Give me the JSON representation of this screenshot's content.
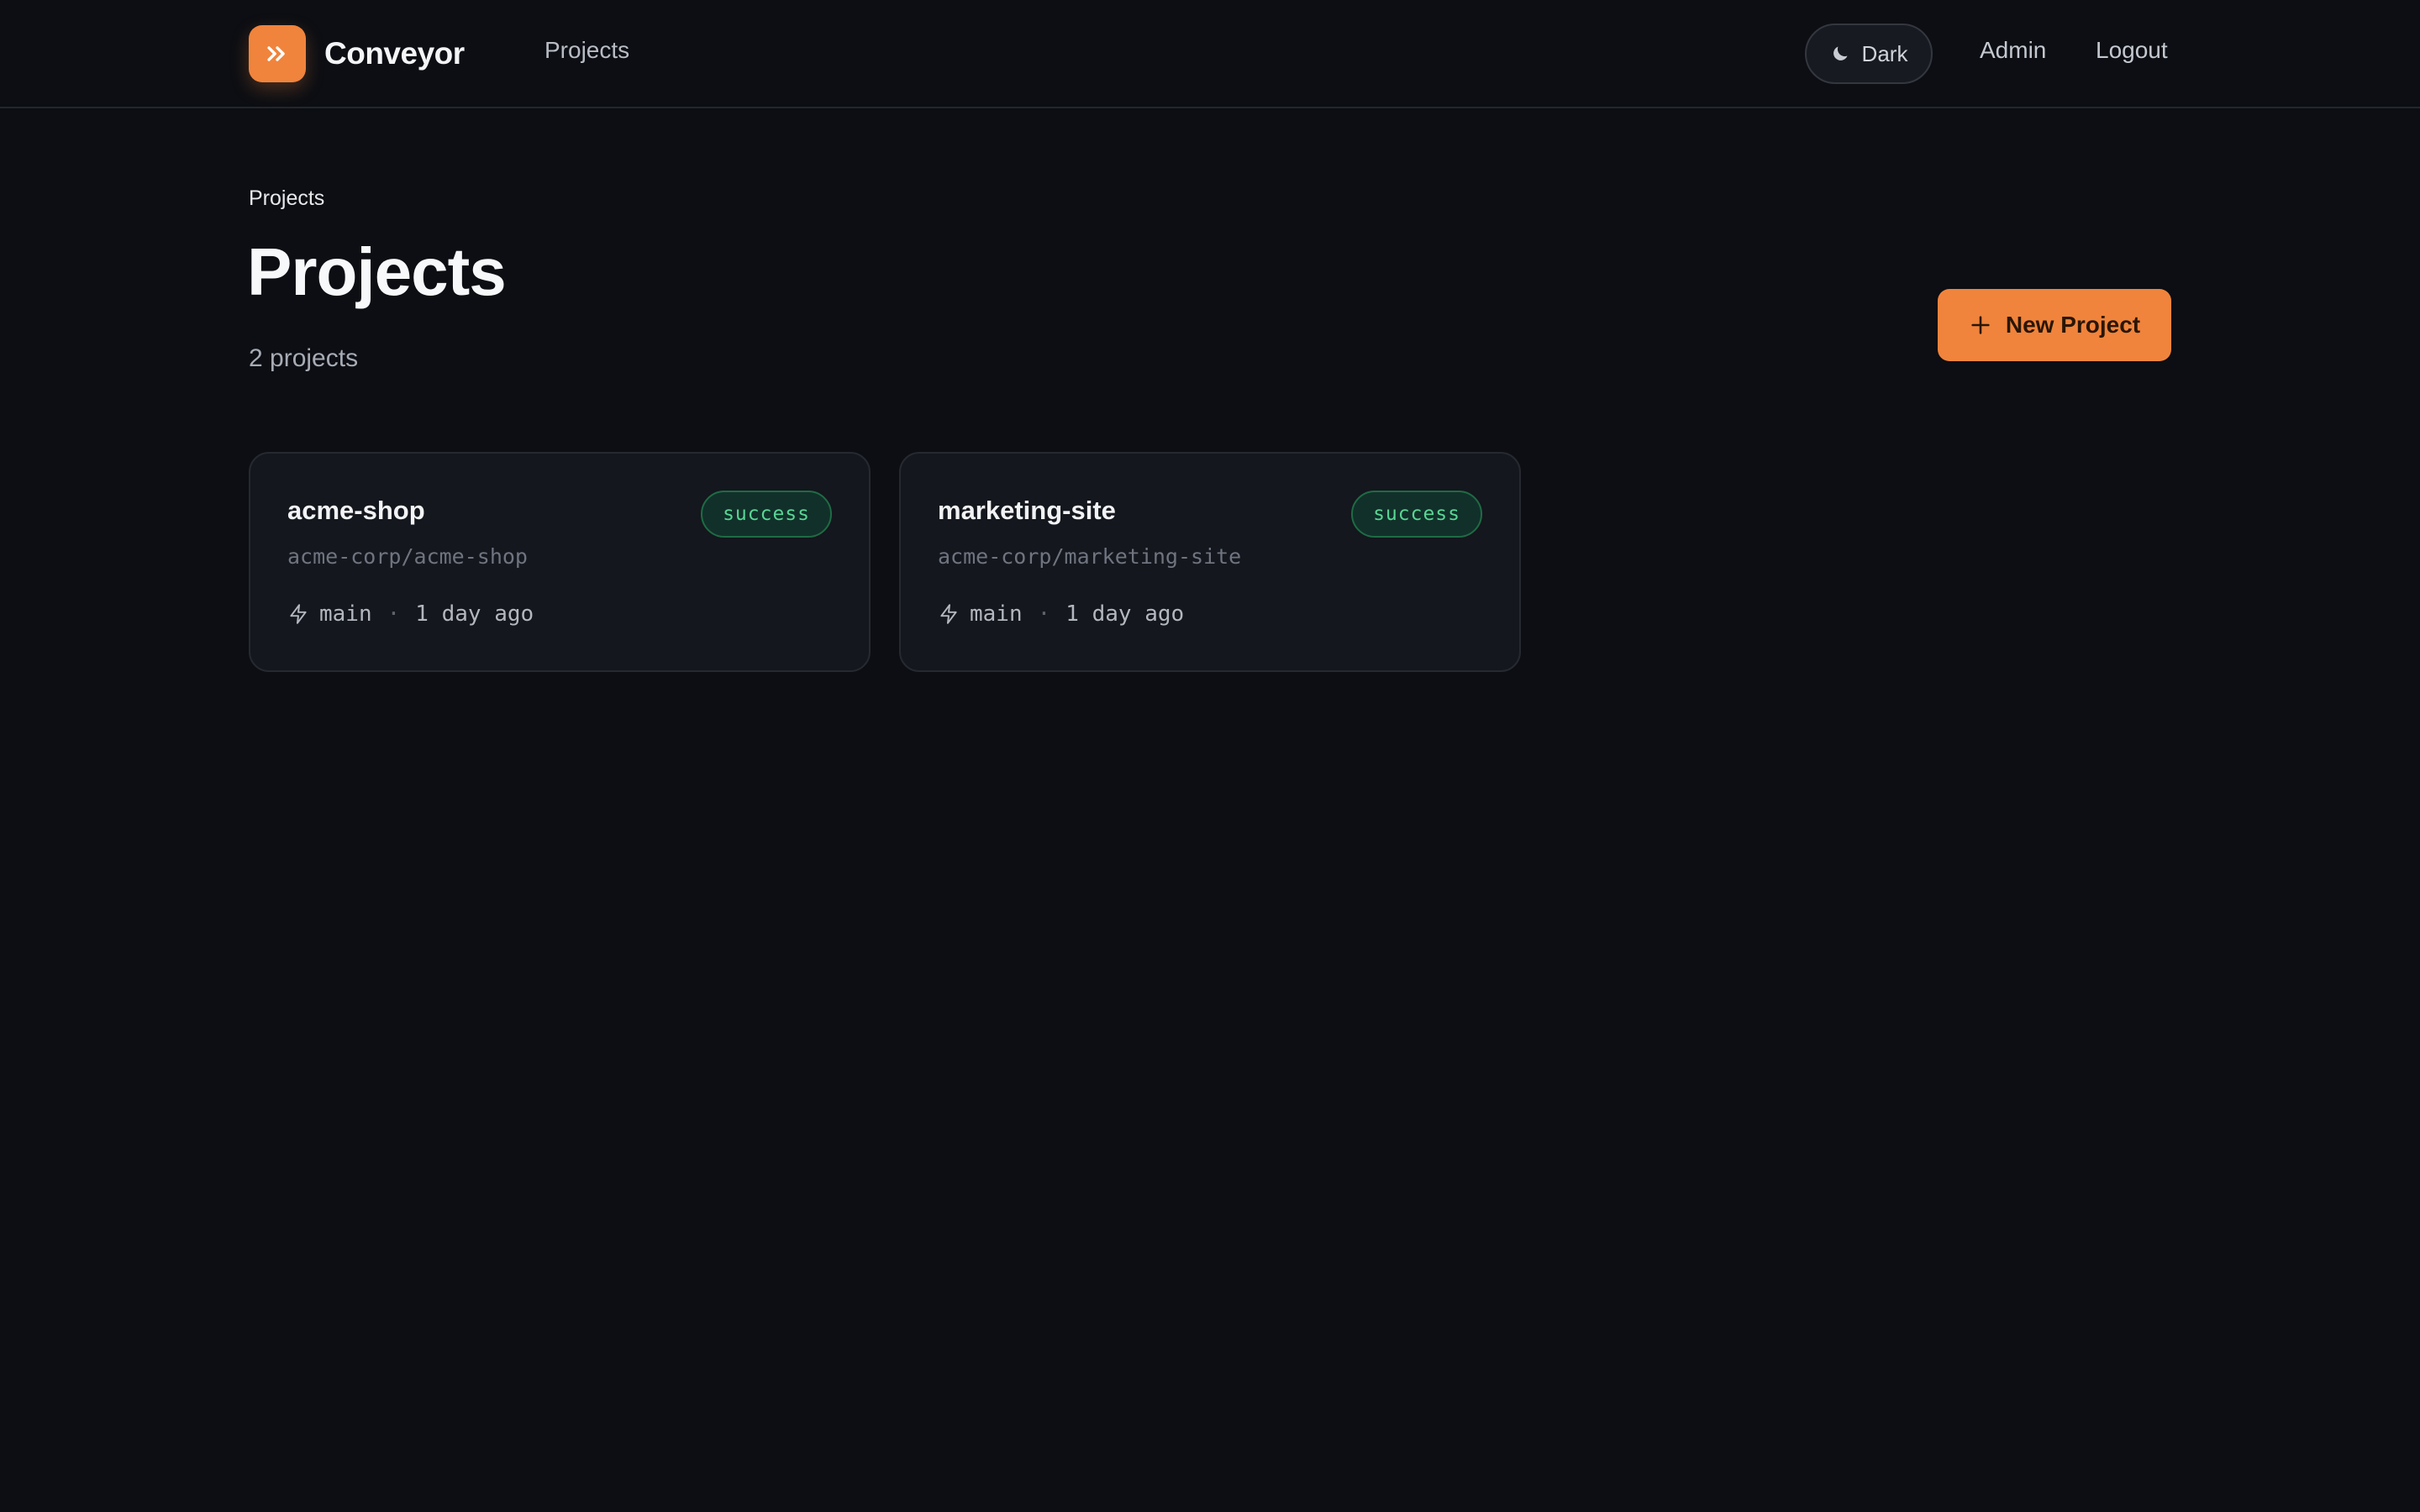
{
  "brand": {
    "name": "Conveyor",
    "accent_color": "#f0843c"
  },
  "nav": {
    "projects_label": "Projects",
    "theme_label": "Dark",
    "theme_icon": "moon-icon",
    "admin_label": "Admin",
    "logout_label": "Logout"
  },
  "page": {
    "breadcrumb": "Projects",
    "title": "Projects",
    "count_text": "2 projects",
    "new_project_label": "New Project"
  },
  "projects": [
    {
      "name": "acme-shop",
      "repo": "acme-corp/acme-shop",
      "status": "success",
      "branch": "main",
      "separator": "·",
      "updated": "1 day ago"
    },
    {
      "name": "marketing-site",
      "repo": "acme-corp/marketing-site",
      "status": "success",
      "branch": "main",
      "separator": "·",
      "updated": "1 day ago"
    }
  ],
  "colors": {
    "background": "#0c0e13",
    "card_background": "#14171d",
    "success_text": "#58d694",
    "success_background": "#12302a"
  }
}
